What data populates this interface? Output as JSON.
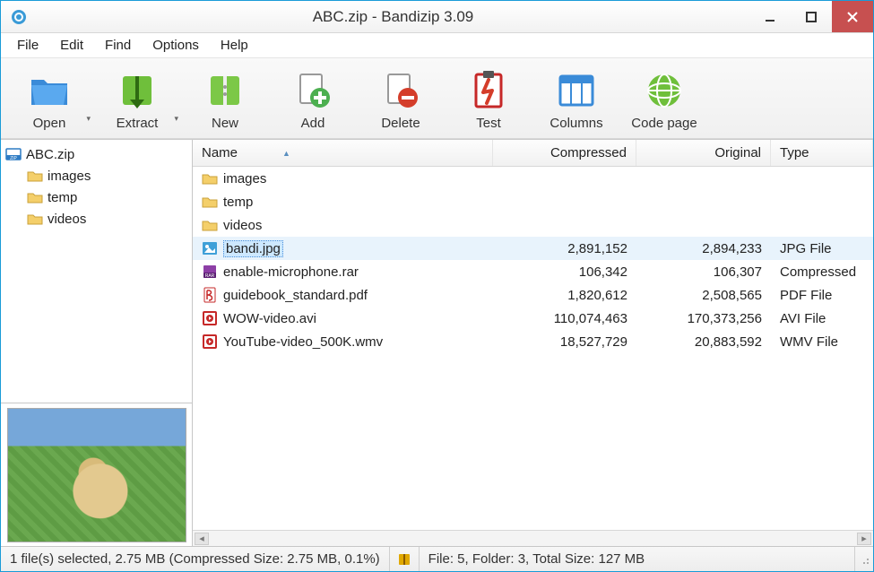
{
  "window": {
    "title": "ABC.zip - Bandizip 3.09"
  },
  "menubar": [
    "File",
    "Edit",
    "Find",
    "Options",
    "Help"
  ],
  "toolbar": [
    {
      "id": "open",
      "label": "Open",
      "icon": "folder-open",
      "hasDropdown": true
    },
    {
      "id": "extract",
      "label": "Extract",
      "icon": "extract",
      "hasDropdown": true
    },
    {
      "id": "new",
      "label": "New",
      "icon": "new-archive",
      "hasDropdown": false
    },
    {
      "id": "add",
      "label": "Add",
      "icon": "add",
      "hasDropdown": false
    },
    {
      "id": "delete",
      "label": "Delete",
      "icon": "delete",
      "hasDropdown": false
    },
    {
      "id": "test",
      "label": "Test",
      "icon": "test",
      "hasDropdown": false
    },
    {
      "id": "columns",
      "label": "Columns",
      "icon": "columns",
      "hasDropdown": false
    },
    {
      "id": "codepage",
      "label": "Code page",
      "icon": "codepage",
      "hasDropdown": false
    }
  ],
  "columns": {
    "name": "Name",
    "compressed": "Compressed",
    "original": "Original",
    "type": "Type",
    "sortedBy": "name",
    "sortDir": "asc"
  },
  "tree": {
    "root": {
      "label": "ABC.zip",
      "icon": "zip"
    },
    "children": [
      {
        "label": "images",
        "icon": "folder"
      },
      {
        "label": "temp",
        "icon": "folder"
      },
      {
        "label": "videos",
        "icon": "folder"
      }
    ]
  },
  "files": [
    {
      "name": "images",
      "icon": "folder",
      "compressed": "",
      "original": "",
      "type": "",
      "selected": false
    },
    {
      "name": "temp",
      "icon": "folder",
      "compressed": "",
      "original": "",
      "type": "",
      "selected": false
    },
    {
      "name": "videos",
      "icon": "folder",
      "compressed": "",
      "original": "",
      "type": "",
      "selected": false
    },
    {
      "name": "bandi.jpg",
      "icon": "image",
      "compressed": "2,891,152",
      "original": "2,894,233",
      "type": "JPG File",
      "selected": true
    },
    {
      "name": "enable-microphone.rar",
      "icon": "rar",
      "compressed": "106,342",
      "original": "106,307",
      "type": "Compressed",
      "selected": false
    },
    {
      "name": "guidebook_standard.pdf",
      "icon": "pdf",
      "compressed": "1,820,612",
      "original": "2,508,565",
      "type": "PDF File",
      "selected": false
    },
    {
      "name": "WOW-video.avi",
      "icon": "video",
      "compressed": "110,074,463",
      "original": "170,373,256",
      "type": "AVI File",
      "selected": false
    },
    {
      "name": "YouTube-video_500K.wmv",
      "icon": "video",
      "compressed": "18,527,729",
      "original": "20,883,592",
      "type": "WMV File",
      "selected": false
    }
  ],
  "status": {
    "left": "1 file(s) selected, 2.75 MB (Compressed Size: 2.75 MB, 0.1%)",
    "right": "File: 5, Folder: 3, Total Size: 127 MB"
  },
  "preview": {
    "alt": "bandi.jpg thumbnail"
  }
}
